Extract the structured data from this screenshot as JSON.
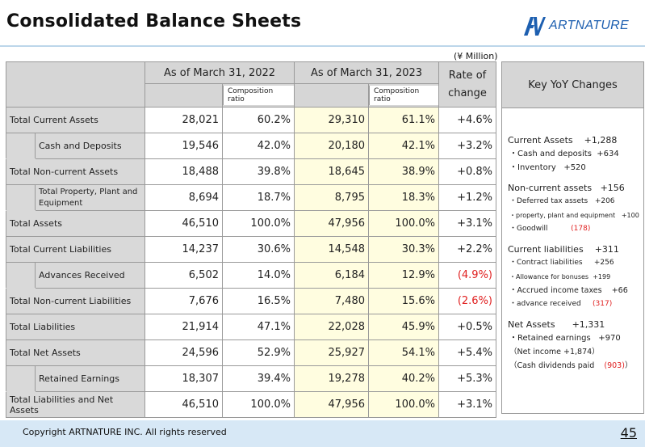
{
  "title": "Consolidated Balance Sheets",
  "logo": {
    "text": "ARTNATURE",
    "mark": "AV"
  },
  "unit_note": "(¥ Million)",
  "table": {
    "headers": {
      "col_2022": "As of March 31, 2022",
      "col_2023": "As of March 31, 2023",
      "composition": "Composition ratio",
      "rate_line1": "Rate of",
      "rate_line2": "change"
    },
    "rows": [
      {
        "label": "Total Current Assets",
        "v22": "28,021",
        "r22": "60.2%",
        "v23": "29,310",
        "r23": "61.1%",
        "chg": "+4.6%"
      },
      {
        "label": "Cash and Deposits",
        "v22": "19,546",
        "r22": "42.0%",
        "v23": "20,180",
        "r23": "42.1%",
        "chg": "+3.2%"
      },
      {
        "label": "Total Non-current Assets",
        "v22": "18,488",
        "r22": "39.8%",
        "v23": "18,645",
        "r23": "38.9%",
        "chg": "+0.8%"
      },
      {
        "label": "Total Property, Plant and Equipment",
        "v22": "8,694",
        "r22": "18.7%",
        "v23": "8,795",
        "r23": "18.3%",
        "chg": "+1.2%"
      },
      {
        "label": "Total Assets",
        "v22": "46,510",
        "r22": "100.0%",
        "v23": "47,956",
        "r23": "100.0%",
        "chg": "+3.1%"
      },
      {
        "label": "Total Current Liabilities",
        "v22": "14,237",
        "r22": "30.6%",
        "v23": "14,548",
        "r23": "30.3%",
        "chg": "+2.2%"
      },
      {
        "label": "Advances Received",
        "v22": "6,502",
        "r22": "14.0%",
        "v23": "6,184",
        "r23": "12.9%",
        "chg": "(4.9%)"
      },
      {
        "label": "Total Non-current Liabilities",
        "v22": "7,676",
        "r22": "16.5%",
        "v23": "7,480",
        "r23": "15.6%",
        "chg": "(2.6%)"
      },
      {
        "label": "Total Liabilities",
        "v22": "21,914",
        "r22": "47.1%",
        "v23": "22,028",
        "r23": "45.9%",
        "chg": "+0.5%"
      },
      {
        "label": "Total Net Assets",
        "v22": "24,596",
        "r22": "52.9%",
        "v23": "25,927",
        "r23": "54.1%",
        "chg": "+5.4%"
      },
      {
        "label": "Retained Earnings",
        "v22": "18,307",
        "r22": "39.4%",
        "v23": "19,278",
        "r23": "40.2%",
        "chg": "+5.3%"
      },
      {
        "label": "Total Liabilities and Net Assets",
        "v22": "46,510",
        "r22": "100.0%",
        "v23": "47,956",
        "r23": "100.0%",
        "chg": "+3.1%"
      }
    ]
  },
  "key_changes": {
    "heading": "Key YoY Changes",
    "current_assets": {
      "label": "Current Assets",
      "value": "+1,288"
    },
    "cash": {
      "label": "・Cash and deposits",
      "value": "+634"
    },
    "inventory": {
      "label": "・Inventory",
      "value": "+520"
    },
    "noncurrent_assets": {
      "label": "Non-current assets",
      "value": "+156"
    },
    "deferred_tax": {
      "label": "・Deferred tax assets",
      "value": "+206"
    },
    "ppe": {
      "label": "・property, plant and equipment",
      "value": "+100"
    },
    "goodwill": {
      "label": "・Goodwill",
      "value": "(178)"
    },
    "current_liabilities": {
      "label": "Current liabilities",
      "value": "+311"
    },
    "contract_liabilities": {
      "label": "・Contract liabilities",
      "value": "+256"
    },
    "allowance_bonuses": {
      "label": "・Allowance for bonuses",
      "value": "+199"
    },
    "accrued_income_taxes": {
      "label": "・Accrued income taxes",
      "value": "+66"
    },
    "advance_received": {
      "label": "・advance received",
      "value": "(317)"
    },
    "net_assets": {
      "label": "Net Assets",
      "value": "+1,331"
    },
    "retained_earnings": {
      "label": "・Retained earnings",
      "value": "+970"
    },
    "net_income": "（Net income +1,874）",
    "cash_dividends": {
      "label": "（Cash dividends paid",
      "value": "(903)",
      "close": "）"
    }
  },
  "footer": {
    "copyright": "Copyright ARTNATURE INC. All rights reserved",
    "page": "45"
  },
  "colors": {
    "header_gray": "#d6d6d6",
    "highlight_2023": "#fffde0",
    "negative_red": "#e02020",
    "footer_band": "#d7e8f6",
    "brand_blue": "#1d5fb0"
  }
}
